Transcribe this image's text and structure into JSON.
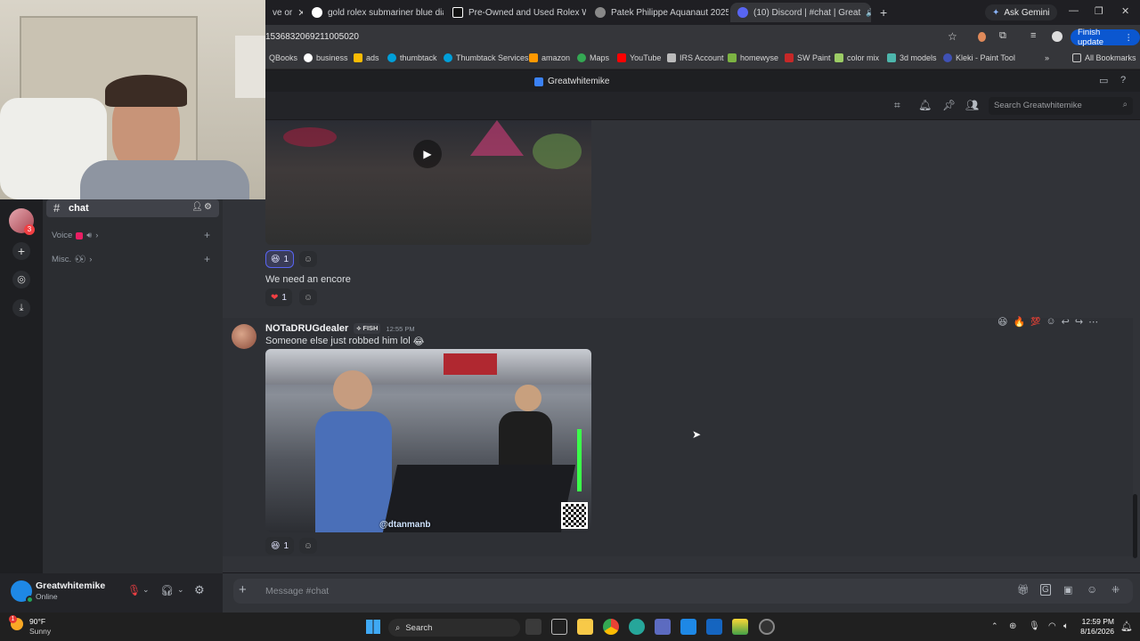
{
  "browser": {
    "tabs": [
      {
        "label": "ve or",
        "active": false
      },
      {
        "label": "gold rolex submariner blue dia",
        "active": false
      },
      {
        "label": "Pre-Owned and Used Rolex Wa",
        "active": false
      },
      {
        "label": "Patek Philippe Aquanaut 2025 I",
        "active": false
      },
      {
        "label": "(10) Discord | #chat | Great",
        "active": true
      }
    ],
    "ask_gemini": "Ask Gemini",
    "url": "1536832069211005020",
    "finish_update": "Finish update",
    "bookmarks": [
      "QBooks",
      "business",
      "ads",
      "thumbtack",
      "Thumbtack Services",
      "amazon",
      "Maps",
      "YouTube",
      "IRS Account",
      "homewyse",
      "SW Paint",
      "color mix",
      "3d models",
      "Kleki - Paint Tool"
    ],
    "all_bookmarks": "All Bookmarks"
  },
  "discord": {
    "server_title": "Greatwhitemike",
    "search_placeholder": "Search Greatwhitemike",
    "channels": {
      "current": "chat",
      "voice": "Voice",
      "misc": "Misc."
    },
    "messages": {
      "reaction_1_count": "1",
      "text_encore": "We need an encore",
      "reaction_2_count": "1",
      "author": "NOTaDRUGdealer",
      "badge": "FISH",
      "time": "12:55 PM",
      "text_robbed": "Someone else just robbed him lol",
      "watermark": "@dtanmanb",
      "reaction_3_count": "1"
    },
    "composer_placeholder": "Message #chat",
    "user": {
      "name": "Greatwhitemike",
      "status": "Online"
    }
  },
  "taskbar": {
    "weather_temp": "90°F",
    "weather_text": "Sunny",
    "search": "Search",
    "time": "12:59 PM",
    "date": "8/16/2026",
    "notification_badge": "1"
  },
  "colors": {
    "blurple": "#5865f2",
    "chrome_dark": "#1f1f23",
    "discord_bg": "#313338"
  }
}
